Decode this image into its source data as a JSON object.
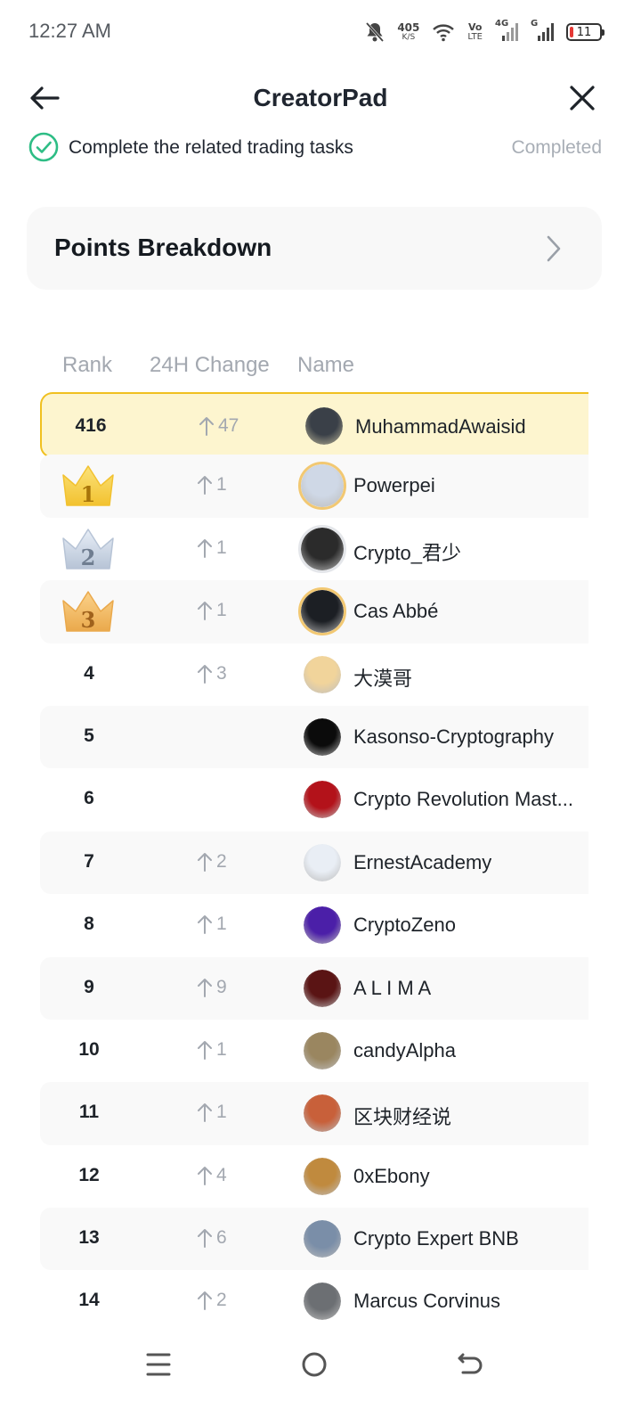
{
  "status_bar": {
    "time": "12:27 AM",
    "net_speed_value": "405",
    "net_speed_unit": "K/S",
    "volte_top": "Vo",
    "volte_bottom": "LTE",
    "sig1_label": "4G",
    "sig2_label": "G",
    "battery": "11",
    "battery_color": "#e53935"
  },
  "header": {
    "title": "CreatorPad"
  },
  "task": {
    "label": "Complete the related trading tasks",
    "status": "Completed",
    "check_color": "#2ebd85"
  },
  "breakdown": {
    "title": "Points Breakdown"
  },
  "table": {
    "headers": {
      "rank": "Rank",
      "change": "24H Change",
      "name": "Name"
    },
    "rows": [
      {
        "rank": "416",
        "change": "47",
        "name": "MuhammadAwaisid",
        "highlight": true
      },
      {
        "rank": "1",
        "change": "1",
        "name": "Powerpei",
        "crown": "gold"
      },
      {
        "rank": "2",
        "change": "1",
        "name": "Crypto_君少",
        "crown": "silver"
      },
      {
        "rank": "3",
        "change": "1",
        "name": "Cas Abbé",
        "crown": "bronze"
      },
      {
        "rank": "4",
        "change": "3",
        "name": "大漠哥"
      },
      {
        "rank": "5",
        "change": "",
        "name": "Kasonso-Cryptography"
      },
      {
        "rank": "6",
        "change": "",
        "name": "Crypto Revolution Mast..."
      },
      {
        "rank": "7",
        "change": "2",
        "name": "ErnestAcademy"
      },
      {
        "rank": "8",
        "change": "1",
        "name": "CryptoZeno"
      },
      {
        "rank": "9",
        "change": "9",
        "name": "A L I M A"
      },
      {
        "rank": "10",
        "change": "1",
        "name": "candyAlpha"
      },
      {
        "rank": "11",
        "change": "1",
        "name": "区块财经说"
      },
      {
        "rank": "12",
        "change": "4",
        "name": "0xEbony"
      },
      {
        "rank": "13",
        "change": "6",
        "name": "Crypto Expert BNB"
      },
      {
        "rank": "14",
        "change": "2",
        "name": "Marcus Corvinus"
      }
    ]
  },
  "colors": {
    "highlight_bg": "#fdf5cf",
    "highlight_border": "#f0c020",
    "muted_text": "#a3a8b0"
  }
}
